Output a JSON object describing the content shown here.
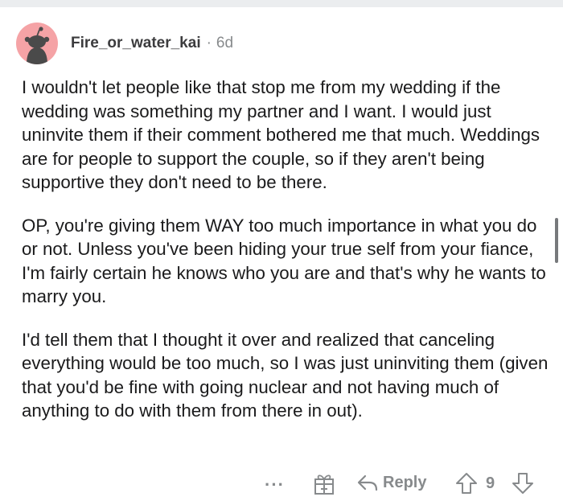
{
  "comment": {
    "author": "Fire_or_water_kai",
    "separator": "·",
    "age": "6d",
    "paragraphs": [
      "I wouldn't let people like that stop me from my wedding if the wedding was something my partner and I want. I would just uninvite them if their comment bothered me that much. Weddings are for people to support the couple, so if they aren't being supportive they don't need to be there.",
      "OP, you're giving them WAY too much importance in what you do or not. Unless you've been hiding your true self from your fiance, I'm fairly certain he knows who you are and that's why he wants to marry you.",
      "I'd tell them that I thought it over and realized that canceling everything would be too much, so I was just uninviting them (given that you'd be fine with going nuclear and not having much of anything to do with them from there in out)."
    ]
  },
  "actions": {
    "more_label": "···",
    "reply_label": "Reply",
    "score": "9"
  },
  "icons": {
    "avatar": "reddit-snoo-avatar",
    "award": "award-gift-icon",
    "reply": "reply-arrow-icon",
    "upvote": "upvote-arrow-icon",
    "downvote": "downvote-arrow-icon"
  },
  "colors": {
    "avatar_bg": "#f5a3a6",
    "muted": "#878a8c",
    "text": "#1a1a1b"
  }
}
